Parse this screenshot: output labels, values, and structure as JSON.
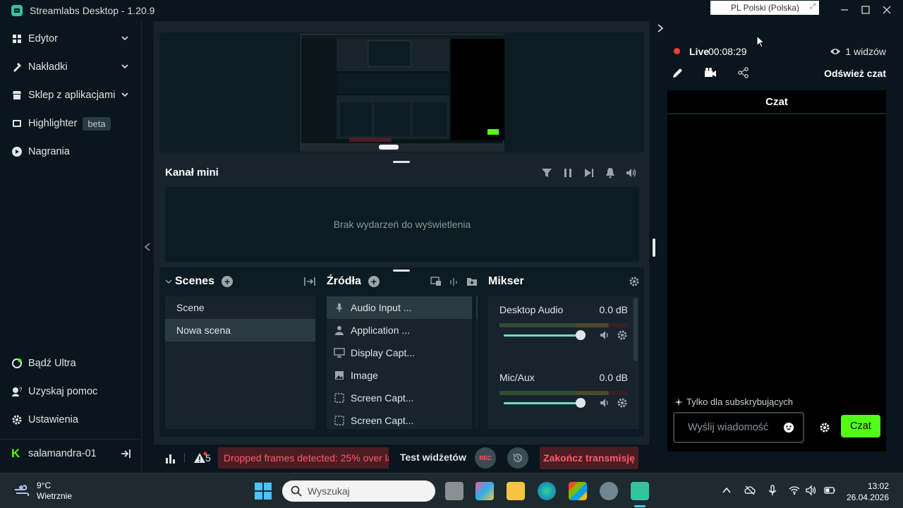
{
  "window": {
    "title": "Streamlabs Desktop - 1.20.9"
  },
  "language_indicator": "PL  Polski (Polska)",
  "leftnav": {
    "items": [
      {
        "label": "Edytor"
      },
      {
        "label": "Nakładki"
      },
      {
        "label": "Sklep z aplikacjami"
      },
      {
        "label": "Highlighter",
        "badge": "beta"
      },
      {
        "label": "Nagrania"
      }
    ],
    "bottom": [
      {
        "label": "Bądź Ultra"
      },
      {
        "label": "Uzyskaj pomoc"
      },
      {
        "label": "Ustawienia"
      }
    ],
    "user": "salamandra-01"
  },
  "minifeed": {
    "title": "Kanał mini",
    "empty": "Brak wydarzeń do wyświetlenia"
  },
  "scenes": {
    "title": "Scenes",
    "items": [
      "Scene",
      "Nowa scena"
    ],
    "active_index": 1
  },
  "sources": {
    "title": "Źródła",
    "items": [
      {
        "label": "Audio Input ...",
        "icon": "microphone-icon"
      },
      {
        "label": "Application ...",
        "icon": "user-icon"
      },
      {
        "label": "Display Capt...",
        "icon": "monitor-icon"
      },
      {
        "label": "Image",
        "icon": "image-icon"
      },
      {
        "label": "Screen Capt...",
        "icon": "screen-capture-icon"
      },
      {
        "label": "Screen Capt...",
        "icon": "screen-capture-icon"
      }
    ]
  },
  "mixer": {
    "title": "Mikser",
    "items": [
      {
        "name": "Desktop Audio",
        "db": "0.0 dB",
        "level": 0.82
      },
      {
        "name": "Mic/Aux",
        "db": "0.0 dB",
        "level": 0.82
      }
    ]
  },
  "footer": {
    "warnings": "5",
    "error": "Dropped frames detected: 25% over la",
    "test_widgets": "Test widżetów",
    "rec": "REC",
    "end_stream": "Zakończ transmisję"
  },
  "chat": {
    "live": "Live",
    "time": "00:08:29",
    "viewers": "1 widzów",
    "refresh": "Odśwież czat",
    "title": "Czat",
    "sub_only": "Tylko dla subskrybujących",
    "input_placeholder": "Wyślij wiadomość",
    "send": "Czat"
  },
  "taskbar": {
    "weather_temp": "9°C",
    "weather_desc": "Wietrznie",
    "search": "Wyszukaj",
    "time": "13:02",
    "date": "26.04.2026"
  },
  "colors": {
    "accent": "#31c3a2",
    "kick_green": "#53fc18",
    "danger": "#ff5a66",
    "live_red": "#ff3b3b"
  }
}
